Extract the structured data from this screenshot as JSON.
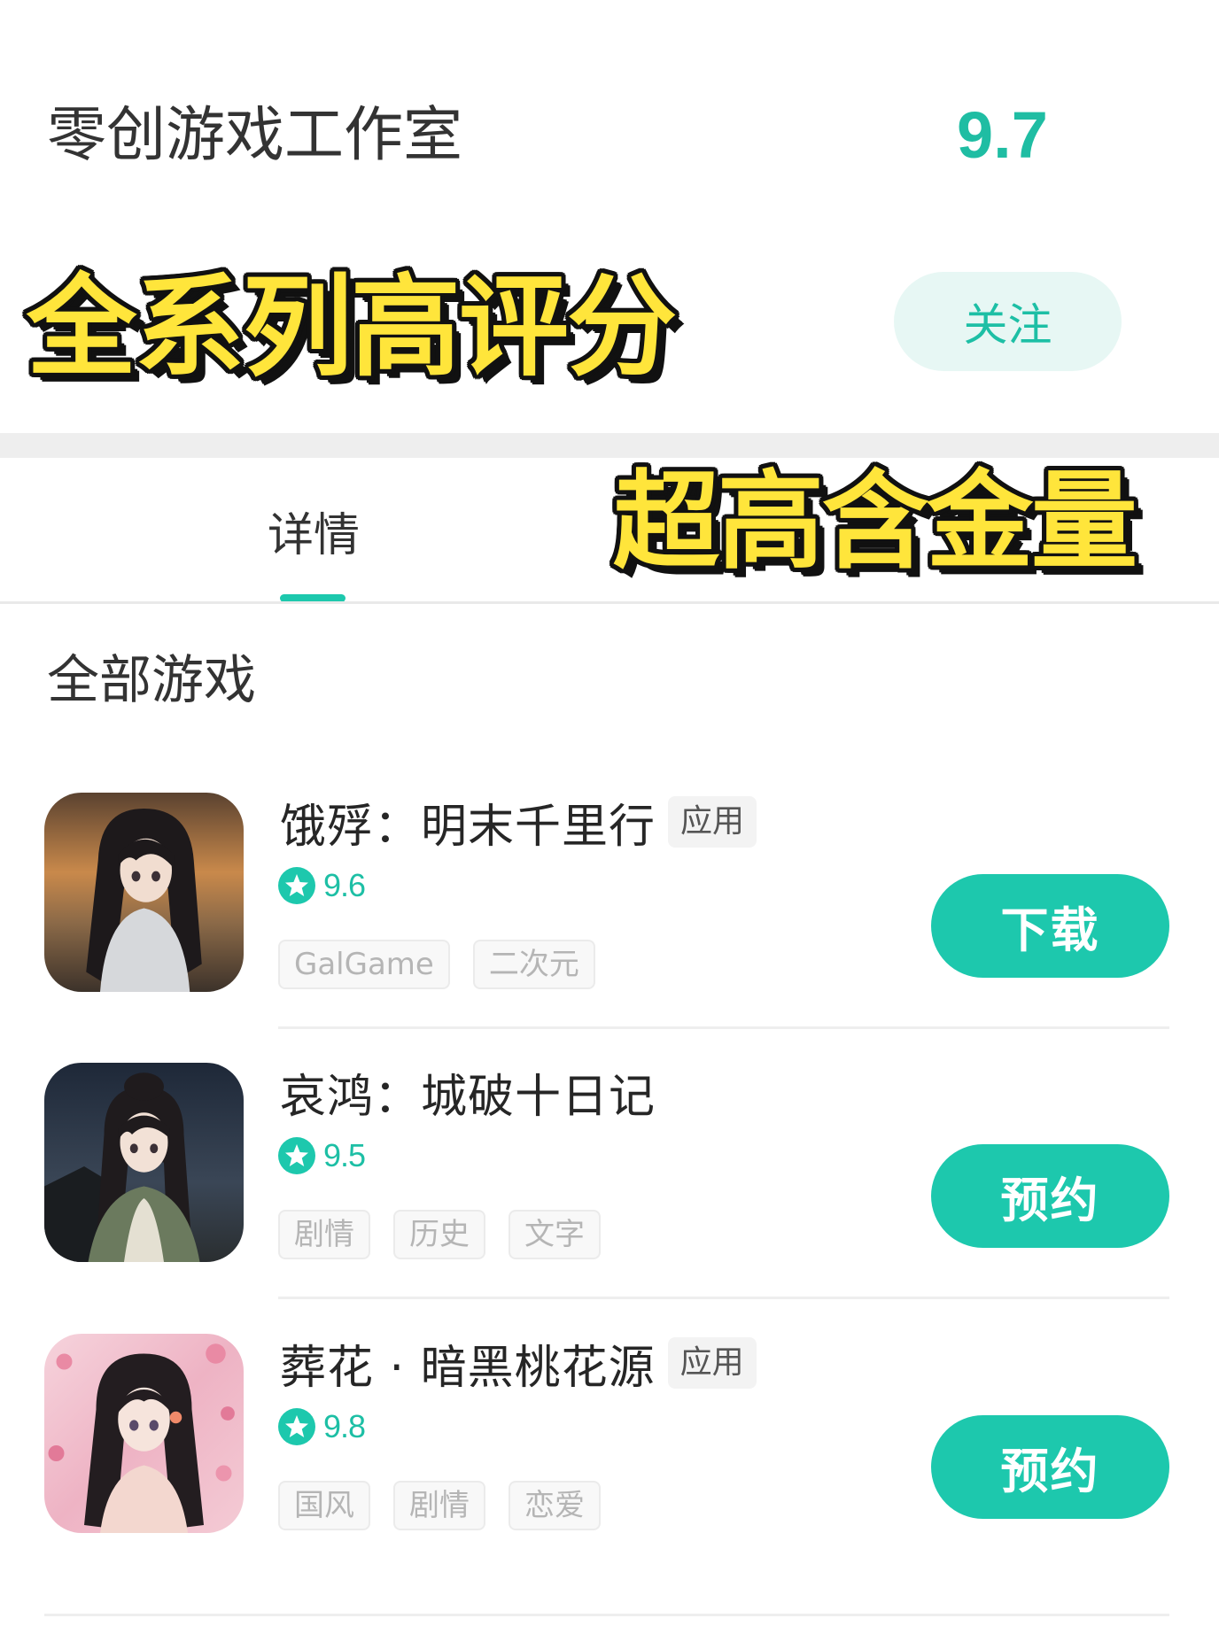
{
  "studio": {
    "name": "零创游戏工作室",
    "score": "9.7",
    "follow_label": "关注"
  },
  "promo": {
    "line1": "全系列高评分",
    "line2": "超高含金量"
  },
  "tabs": [
    {
      "label": "详情",
      "active": true
    }
  ],
  "section_title": "全部游戏",
  "games": [
    {
      "title": "饿殍：明末千里行",
      "badge": "应用",
      "rating": "9.6",
      "tags": [
        "GalGame",
        "二次元"
      ],
      "action": "下载"
    },
    {
      "title": "哀鸿：城破十日记",
      "rating": "9.5",
      "tags": [
        "剧情",
        "历史",
        "文字"
      ],
      "action": "预约"
    },
    {
      "title": "葬花 · 暗黑桃花源",
      "badge": "应用",
      "rating": "9.8",
      "tags": [
        "国风",
        "剧情",
        "恋爱"
      ],
      "action": "预约"
    }
  ],
  "icons": {
    "rating": "star-icon"
  },
  "colors": {
    "accent": "#1dc8ad",
    "score": "#1fbda3",
    "follow_bg": "#e7f7f4",
    "promo_fill": "#ffe53b",
    "promo_outline": "#111111"
  }
}
